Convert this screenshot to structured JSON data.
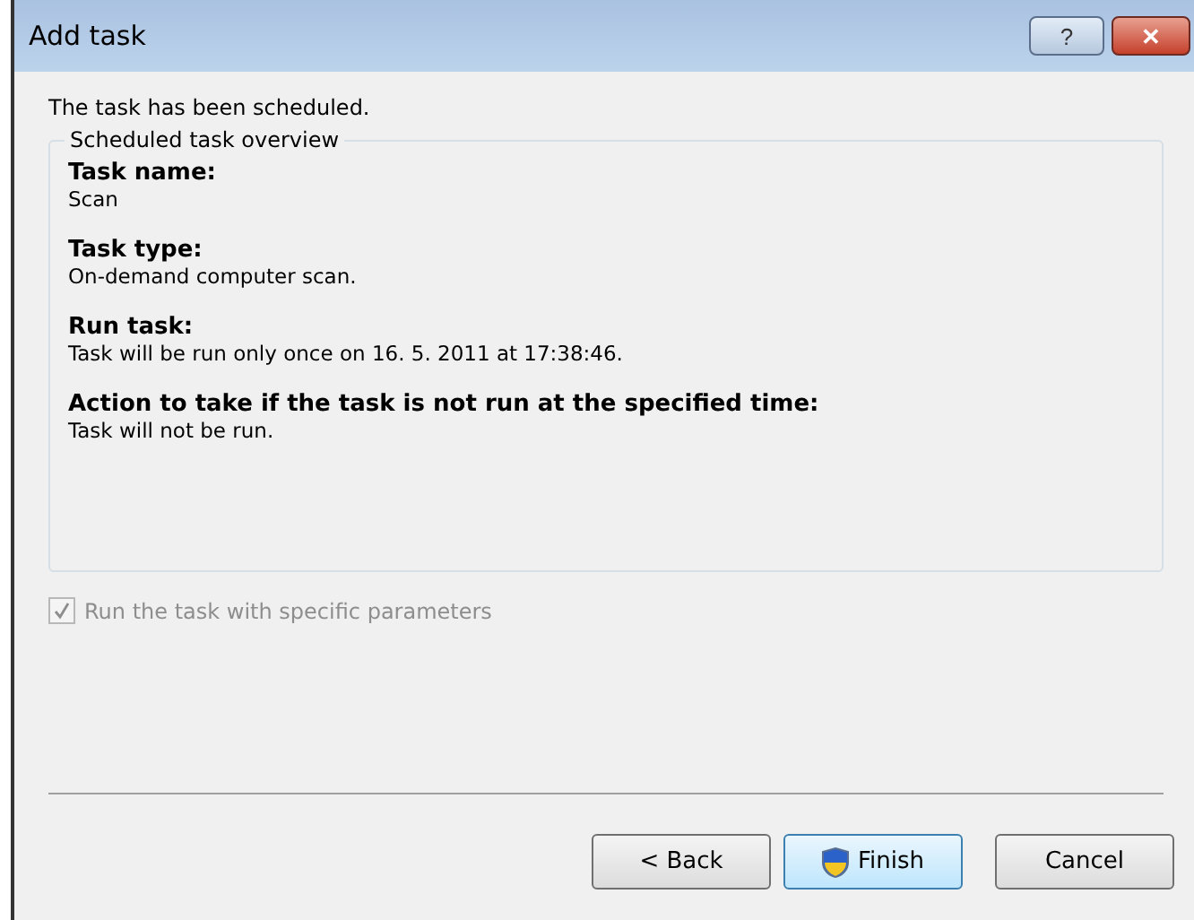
{
  "window": {
    "title": "Add task",
    "buttons": [
      "?",
      "✕"
    ]
  },
  "message": "The task has been scheduled.",
  "overview": {
    "title": "Scheduled task overview",
    "items": [
      {
        "label": "Task name:",
        "value": "Scan"
      },
      {
        "label": "Task type:",
        "value": "On-demand computer scan."
      },
      {
        "label": "Run task:",
        "value": "Task will be run only once on 16. 5. 2011 at 17:38:46."
      },
      {
        "label": "Action to take if the task is not run at the specified time:",
        "value": "Task will not be run."
      }
    ]
  },
  "option": {
    "label": "Run the task with specific parameters",
    "checked": true,
    "disabled": true
  },
  "buttons": [
    {
      "label": "< Back",
      "kind": "plain",
      "default": false
    },
    {
      "label": "Finish",
      "kind": "shield",
      "default": true
    },
    {
      "label": "Cancel",
      "kind": "plain",
      "default": false
    }
  ]
}
